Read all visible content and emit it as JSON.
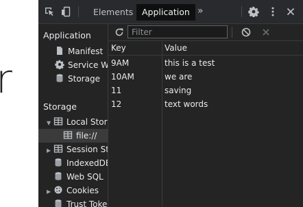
{
  "page": {
    "glyph": "r"
  },
  "toolbar": {
    "tabs": [
      {
        "label": "Elements"
      },
      {
        "label": "Application"
      }
    ],
    "more_tabs": "»"
  },
  "sidebar": {
    "section_application": "Application",
    "app_items": [
      {
        "label": "Manifest"
      },
      {
        "label": "Service Wo"
      },
      {
        "label": "Storage"
      }
    ],
    "section_storage": "Storage",
    "storage_items": [
      {
        "label": "Local Stora"
      },
      {
        "label": "file://"
      },
      {
        "label": "Session Sto"
      },
      {
        "label": "IndexedDB"
      },
      {
        "label": "Web SQL"
      },
      {
        "label": "Cookies"
      },
      {
        "label": "Trust Token"
      }
    ]
  },
  "storage_view": {
    "filter_placeholder": "Filter",
    "columns": {
      "key": "Key",
      "value": "Value"
    },
    "rows": [
      {
        "key": "9AM",
        "value": "this is a test"
      },
      {
        "key": "10AM",
        "value": "we are"
      },
      {
        "key": "11",
        "value": "saving"
      },
      {
        "key": "12",
        "value": "text words"
      }
    ]
  },
  "colors": {
    "panel_bg": "#242424",
    "toolbar_bg": "#292a2d",
    "active_tab_bg": "#0f0f10",
    "selected_row_bg": "#3b3b3b",
    "text": "#e8eaed",
    "separator": "#3c3c3c"
  }
}
